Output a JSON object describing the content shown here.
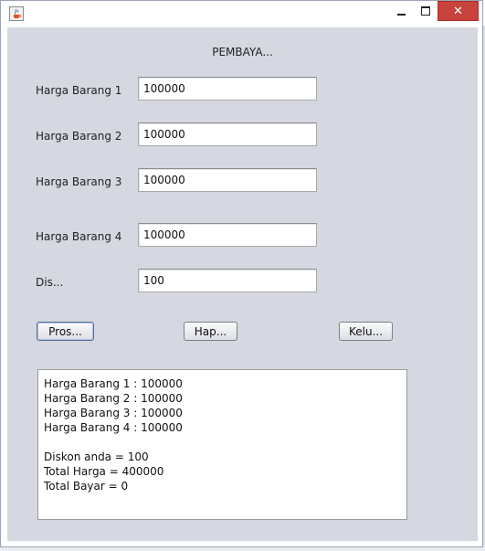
{
  "window": {
    "icon": "java-cup-icon",
    "close_glyph": "✕",
    "colors": {
      "content_bg": "#d5d8e0",
      "close_button": "#c7433c",
      "field_bg": "#ffffff"
    }
  },
  "form": {
    "heading": "PEMBAYA...",
    "fields": [
      {
        "label": "Harga Barang 1",
        "value": "100000"
      },
      {
        "label": "Harga Barang 2",
        "value": "100000"
      },
      {
        "label": "Harga Barang 3",
        "value": "100000"
      },
      {
        "label": "Harga Barang 4",
        "value": "100000"
      },
      {
        "label": "Dis...",
        "value": "100"
      }
    ]
  },
  "buttons": {
    "proses": "Pros...",
    "hapus": "Hap...",
    "keluar": "Kelu..."
  },
  "output": {
    "lines": [
      "Harga Barang 1 : 100000",
      "Harga Barang 2 : 100000",
      "Harga Barang 3 : 100000",
      "Harga Barang 4 : 100000",
      "",
      "Diskon anda = 100",
      "Total Harga = 400000",
      "Total Bayar = 0"
    ]
  }
}
